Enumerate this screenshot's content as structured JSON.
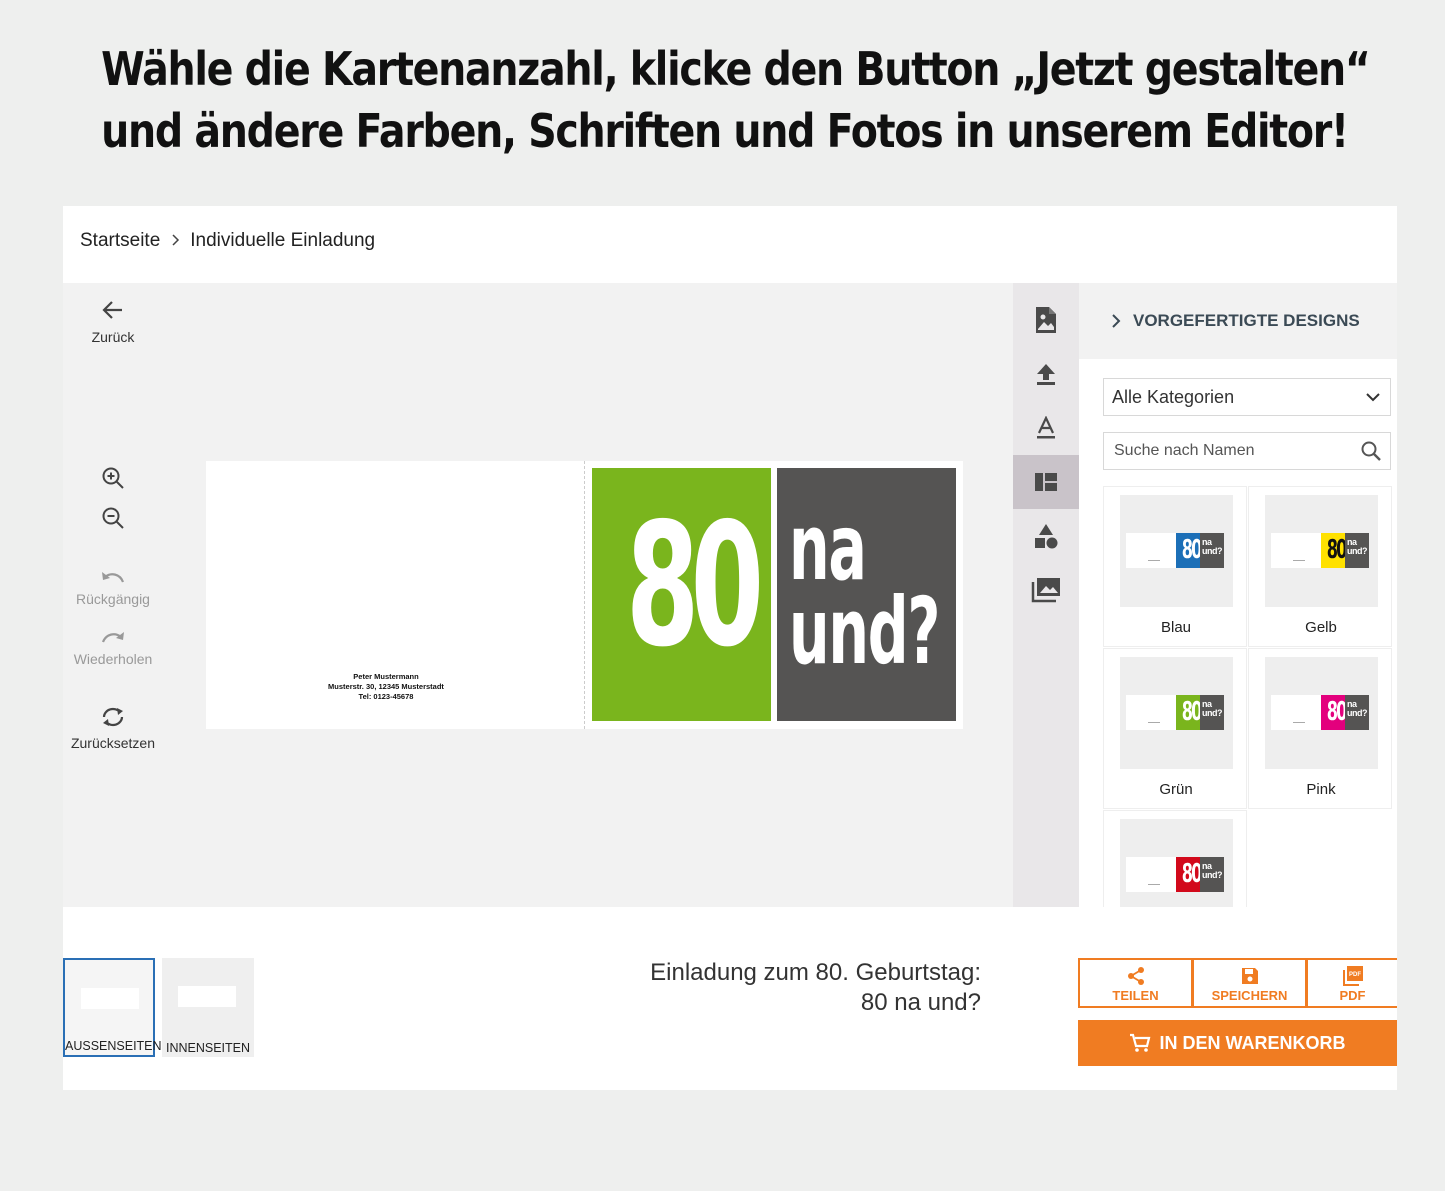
{
  "headline": {
    "line1": "Wähle die Kartenanzahl, klicke den Button „Jetzt gestalten“",
    "line2": "und ändere Farben, Schriften und Fotos in unserem Editor!"
  },
  "breadcrumb": {
    "home": "Startseite",
    "current": "Individuelle Einladung"
  },
  "tools": {
    "back": "Zurück",
    "undo": "Rückgängig",
    "redo": "Wiederholen",
    "reset": "Zurücksetzen"
  },
  "canvas": {
    "address_name": "Peter Mustermann",
    "address_street": "Musterstr. 30, 12345 Musterstadt",
    "address_phone": "Tel: 0123-45678",
    "number": "80",
    "text_line1": "na",
    "text_line2": "und?",
    "accent_color": "#7ab51d"
  },
  "sidebar_icons": [
    "image-edit-icon",
    "upload-icon",
    "text-icon",
    "layout-icon",
    "shapes-icon",
    "gallery-icon"
  ],
  "panel": {
    "title": "VORGEFERTIGTE DESIGNS",
    "category": "Alle Kategorien",
    "search_placeholder": "Suche nach Namen",
    "thumb_number": "80",
    "thumb_text_line1": "na",
    "thumb_text_line2": "und?",
    "designs": [
      {
        "name": "Blau",
        "color": "#1c6fb7",
        "text": "#ffffff"
      },
      {
        "name": "Gelb",
        "color": "#ffe100",
        "text": "#111111"
      },
      {
        "name": "Grün",
        "color": "#7ab51d",
        "text": "#ffffff"
      },
      {
        "name": "Pink",
        "color": "#e3007d",
        "text": "#ffffff"
      },
      {
        "name": "",
        "color": "#d2091b",
        "text": "#ffffff"
      }
    ]
  },
  "pages": {
    "outside": "AUSSENSEITEN",
    "inside": "INNENSEITEN"
  },
  "product_title": "Einladung zum 80. Geburtstag: 80 na und?",
  "actions": {
    "share": "TEILEN",
    "save": "SPEICHERN",
    "pdf": "PDF",
    "cart": "IN DEN WARENKORB"
  },
  "colors": {
    "brand_orange": "#f07c22",
    "active_blue": "#2a6fb5"
  }
}
